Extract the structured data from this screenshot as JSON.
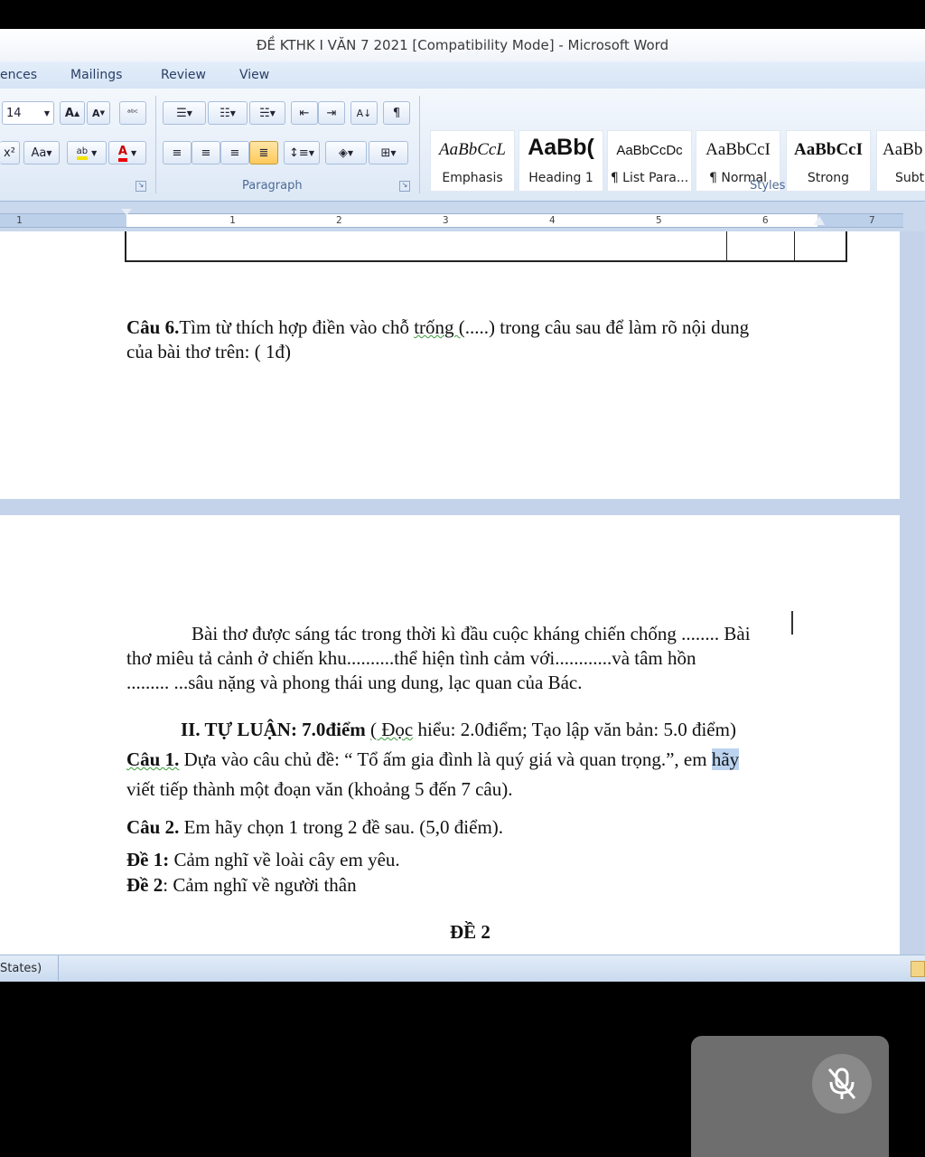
{
  "window": {
    "title": "ĐỀ KTHK I  VĂN 7 2021 [Compatibility Mode] - Microsoft Word"
  },
  "menu": {
    "references": "ences",
    "mailings": "Mailings",
    "review": "Review",
    "view": "View"
  },
  "ribbon": {
    "font_size": "14",
    "grow_font": "A",
    "shrink_font": "A",
    "superscript": "x²",
    "change_case": "Aa",
    "highlight": "ab",
    "font_color": "A",
    "show_marks": "¶",
    "sort": "A↓",
    "groups": {
      "paragraph": "Paragraph",
      "styles": "Styles"
    },
    "styles": [
      {
        "preview": "AaBbCcL",
        "name": "Emphasis"
      },
      {
        "preview": "AaBb(",
        "name": "Heading 1"
      },
      {
        "preview": "AaBbCcDc",
        "name": "¶ List Para..."
      },
      {
        "preview": "AaBbCcI",
        "name": "¶ Normal"
      },
      {
        "preview": "AaBbCcI",
        "name": "Strong"
      },
      {
        "preview": "AaBb",
        "name": "Subt"
      }
    ]
  },
  "ruler": {
    "marks": [
      "1",
      "1",
      "2",
      "3",
      "4",
      "5",
      "6",
      "7"
    ]
  },
  "document": {
    "q6_label": "Câu 6.",
    "q6_text_a": "Tìm từ thích hợp điền vào chỗ ",
    "q6_trong": "trống (",
    "q6_text_b": ".....) trong câu sau để làm rõ nội dung",
    "q6_line2": "của bài thơ trên: ( 1đ)",
    "poem_line1": "Bài thơ được sáng tác trong thời kì đầu cuộc kháng chiến chống ........ Bài",
    "poem_line2": "thơ miêu tả cảnh ở chiến khu..........thể hiện tình cảm với............và tâm hồn",
    "poem_line3": "......... ...sâu nặng và phong thái ung dung, lạc quan của Bác.",
    "section_a": "II. TỰ LUẬN: 7.0điểm ",
    "section_b": "( Đọc",
    "section_c": " hiểu: 2.0điểm; Tạo lập văn bản: 5.0 điểm)",
    "c1_label": "Câu 1.",
    "c1_text": " Dựa vào câu chủ đề: “ Tổ ấm gia đình là quý giá và quan trọng.”,  em ",
    "c1_highlight": "hãy",
    "c1_line2": "viết tiếp thành một đoạn văn (khoảng 5 đến 7 câu).",
    "c2_label": "Câu 2.",
    "c2_text": " Em hãy chọn 1 trong 2 đề sau. (5,0 điểm).",
    "de1_label": "Đề 1:",
    "de1_text": " Cảm nghĩ về loài cây em yêu.",
    "de2_label": "Đề 2",
    "de2_text": ": Cảm nghĩ về người thân",
    "de_heading": "ĐỀ 2"
  },
  "status": {
    "language": "States)"
  },
  "call": {
    "mic_state": "muted",
    "icon": "mic-off-icon"
  }
}
